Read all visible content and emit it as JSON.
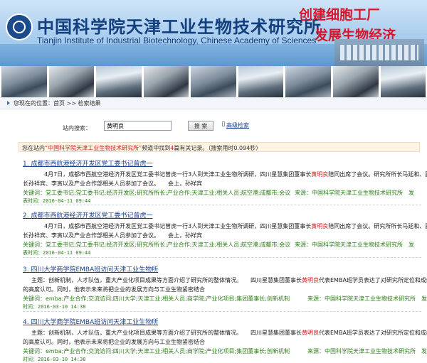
{
  "header": {
    "title_cn": "中国科学院天津工业生物技术研究所",
    "title_en": "Tianjin Institute of Industrial Biotechnology, Chinese Academy of Sciences",
    "slogan_line1": "创建细胞工厂",
    "slogan_line2": "发展生物经济"
  },
  "breadcrumb": {
    "text": "您现在的位置：首页 >> 检索结果"
  },
  "search": {
    "label": "站内搜索：",
    "value": "黄明良",
    "button": "搜 索",
    "advanced": "高级检索"
  },
  "summary": {
    "prefix": "您在站内",
    "site": "“中国科学院天津工业生物技术研究所”",
    "middle": "频道中找到",
    "count": "4",
    "suffix": "篇有关记录。（搜索用时0.094秒）"
  },
  "results": [
    {
      "title": "1. 成都市西航港经济开发区党工委书记曾虎一",
      "snippet_line1_pre": "4月7日，成都市西航空港经济开发区党工委书记曾虎一行3人到天津工业生物所调研，四川星慧集团董事长",
      "snippet_line1_hl": "黄明良",
      "snippet_line1_post": "陪同出席了会议。研究所所长马延和、副所",
      "snippet_line2": "长孙祥宾、李寅以及产业合作部相关人员参加了会议。　　会上，孙祥宾",
      "keywords_label": "关键词：",
      "keywords": "党工委书记;党工委书记;经济开发区;研究所所长;产业合作;天津工业;相关人员;航空港;成都市;会议",
      "source_label": "来源：",
      "source": "中国科学院天津工业生物技术研究所",
      "publish": "发",
      "date": "表时间：2016-04-11 09:44"
    },
    {
      "title": "2. 成都市西航港经济开发区党工委书记曾虎一",
      "snippet_line1_pre": "4月7日，成都市西航空港经济开发区党工委书记曾虎一行3人到天津工业生物所调研，四川星慧集团董事长",
      "snippet_line1_hl": "黄明良",
      "snippet_line1_post": "陪同出席了会议。研究所所长马延和、副所",
      "snippet_line2": "长孙祥宾、李寅以及产业合作部相关人员参加了会议。　　会上，孙祥宾",
      "keywords_label": "关键词：",
      "keywords": "党工委书记;党工委书记;经济开发区;研究所所长;产业合作;天津工业;相关人员;航空港;成都市;会议",
      "source_label": "来源：",
      "source": "中国科学院天津工业生物技术研究所",
      "publish": "发",
      "date": "表时间：2016-04-11 09:44"
    },
    {
      "title": "3. 四川大学商学院EMBA班访问天津工业生物所",
      "snippet_line1_pre": "主题：创新机制，人才队伍，重大产业化项目成果等方面介绍了研究所的整体情况。　　四川星慧集团董事长",
      "snippet_line1_hl": "黄明良",
      "snippet_line1_post": "代表EMBA班学员表达了对研究所定位和成绩",
      "snippet_line2": "的高度认可。同时，他表示未来将把企业的发展方向与工业生物紧密结合",
      "keywords_label": "关键词：",
      "keywords": "emba;产业合作;交流访问;四川大学;天津工业;相关人员;商学院;产业化项目;集团董事长;创新机制",
      "source_label": "来源：",
      "source": "中国科学院天津工业生物技术研究所",
      "publish": "发表",
      "date": "时间：2016-03-10 14:38"
    },
    {
      "title": "4. 四川大学商学院EMBA班访问天津工业生物所",
      "snippet_line1_pre": "主题：创新机制，人才队伍，重大产业化项目成果等方面介绍了研究所的整体情况。　　四川星慧集团董事长",
      "snippet_line1_hl": "黄明良",
      "snippet_line1_post": "代表EMBA班学员表达了对研究所定位和成绩",
      "snippet_line2": "的高度认可。同时，他表示未来将把企业的发展方向与工业生物紧密结合",
      "keywords_label": "关键词：",
      "keywords": "emba;产业合作;交流访问;四川大学;天津工业;相关人员;商学院;产业化项目;集团董事长;创新机制",
      "source_label": "来源：",
      "source": "中国科学院天津工业生物技术研究所",
      "publish": "发表",
      "date": "时间：2016-03-10 14:38"
    }
  ],
  "colors": {
    "link": "#1a3f8c",
    "highlight": "#d61c1c",
    "meta": "#2e7d1a",
    "banner": "#a9cdee"
  },
  "icons": {
    "logo": "cas-logo-icon",
    "breadcrumb": "arrow-right-icon"
  }
}
